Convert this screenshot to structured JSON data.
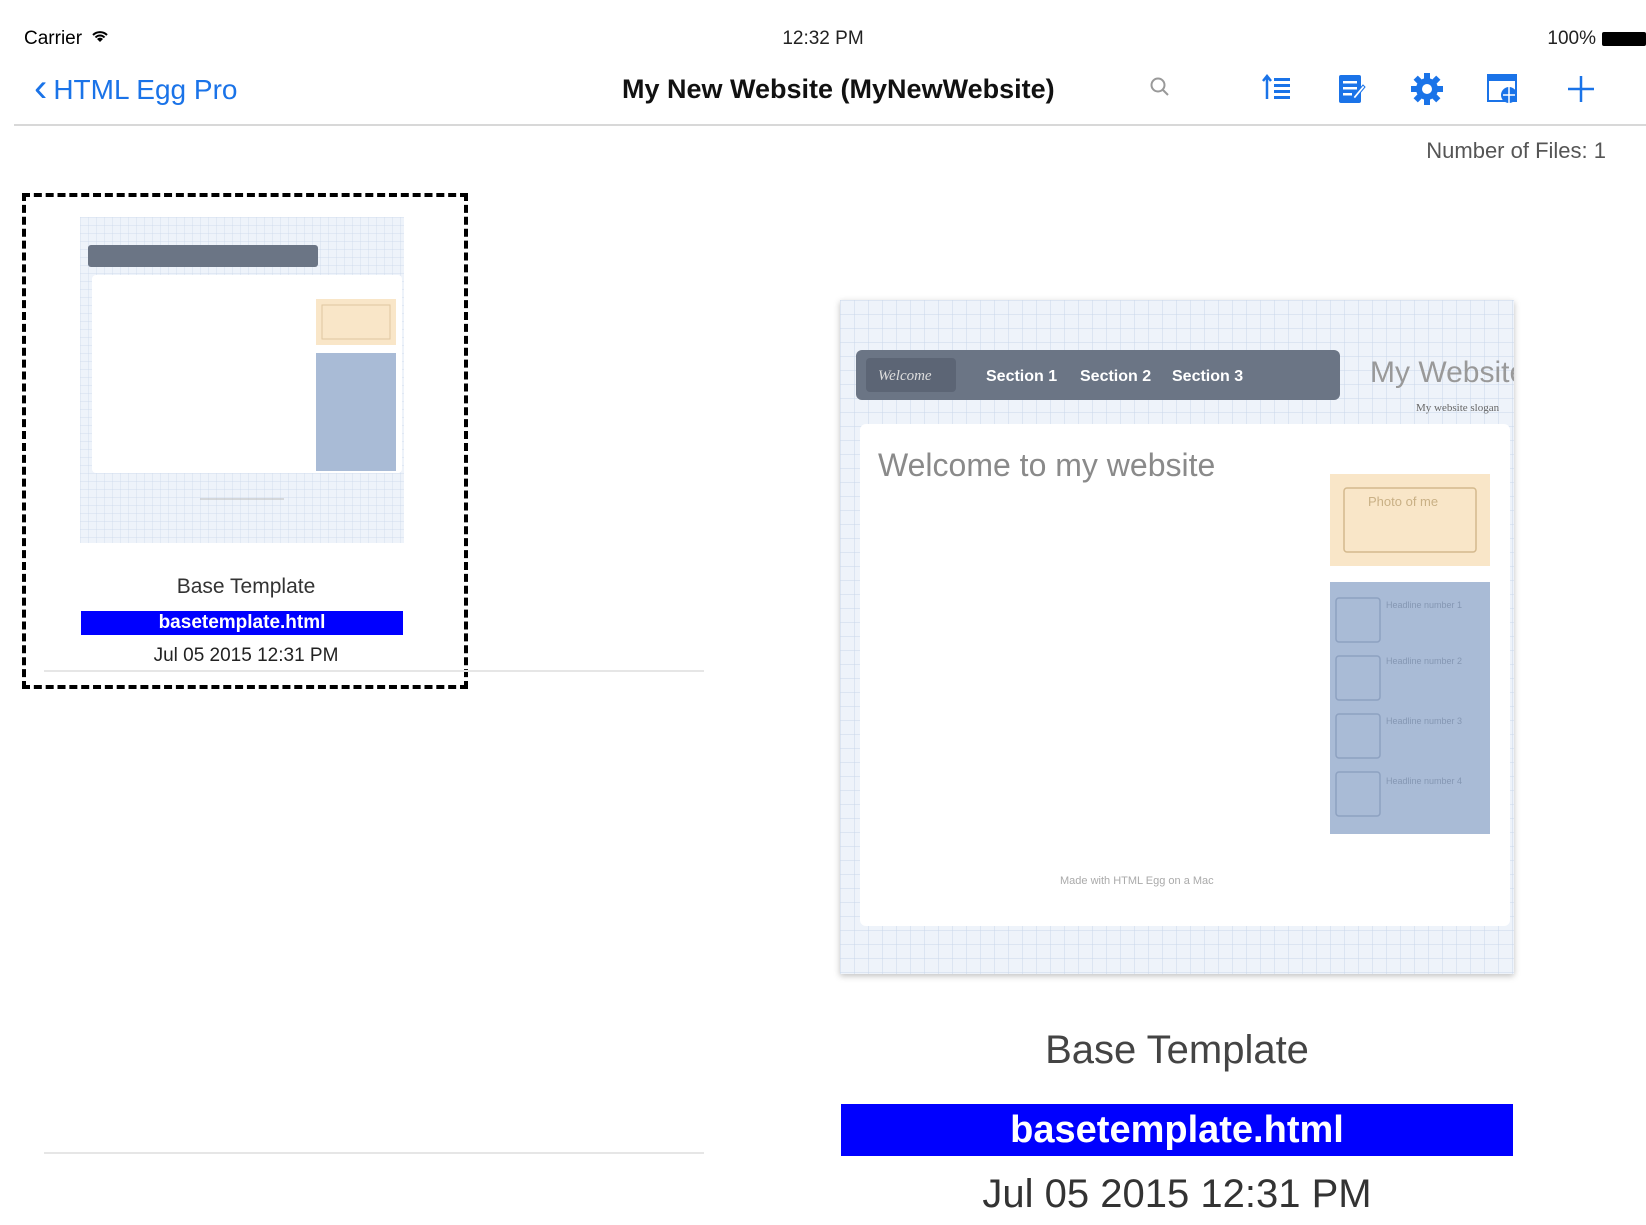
{
  "status": {
    "carrier": "Carrier",
    "time": "12:32 PM",
    "battery": "100%"
  },
  "nav": {
    "back_label": "HTML Egg Pro",
    "title": "My New Website (MyNewWebsite)"
  },
  "file_count": "Number of Files: 1",
  "files": [
    {
      "title": "Base Template",
      "filename": "basetemplate.html",
      "date": "Jul 05 2015 12:31 PM"
    }
  ],
  "preview": {
    "title": "Base Template",
    "filename": "basetemplate.html",
    "date": "Jul 05 2015 12:31 PM",
    "site": {
      "nav_welcome": "Welcome",
      "nav_items": [
        "Section 1",
        "Section 2",
        "Section 3"
      ],
      "site_title": "My Website",
      "slogan": "My website slogan",
      "heading": "Welcome to my website",
      "photo": "Photo of me",
      "headlines": [
        "Headline number 1",
        "Headline number 2",
        "Headline number 3",
        "Headline number 4"
      ],
      "footer": "Made with HTML Egg on a Mac"
    }
  },
  "colors": {
    "accent": "#1a73e8",
    "highlight": "#0000ff",
    "site_nav": "#6b7585",
    "photo_bg": "#f9e6c8",
    "sidebar_bg": "#a9bbd6"
  }
}
